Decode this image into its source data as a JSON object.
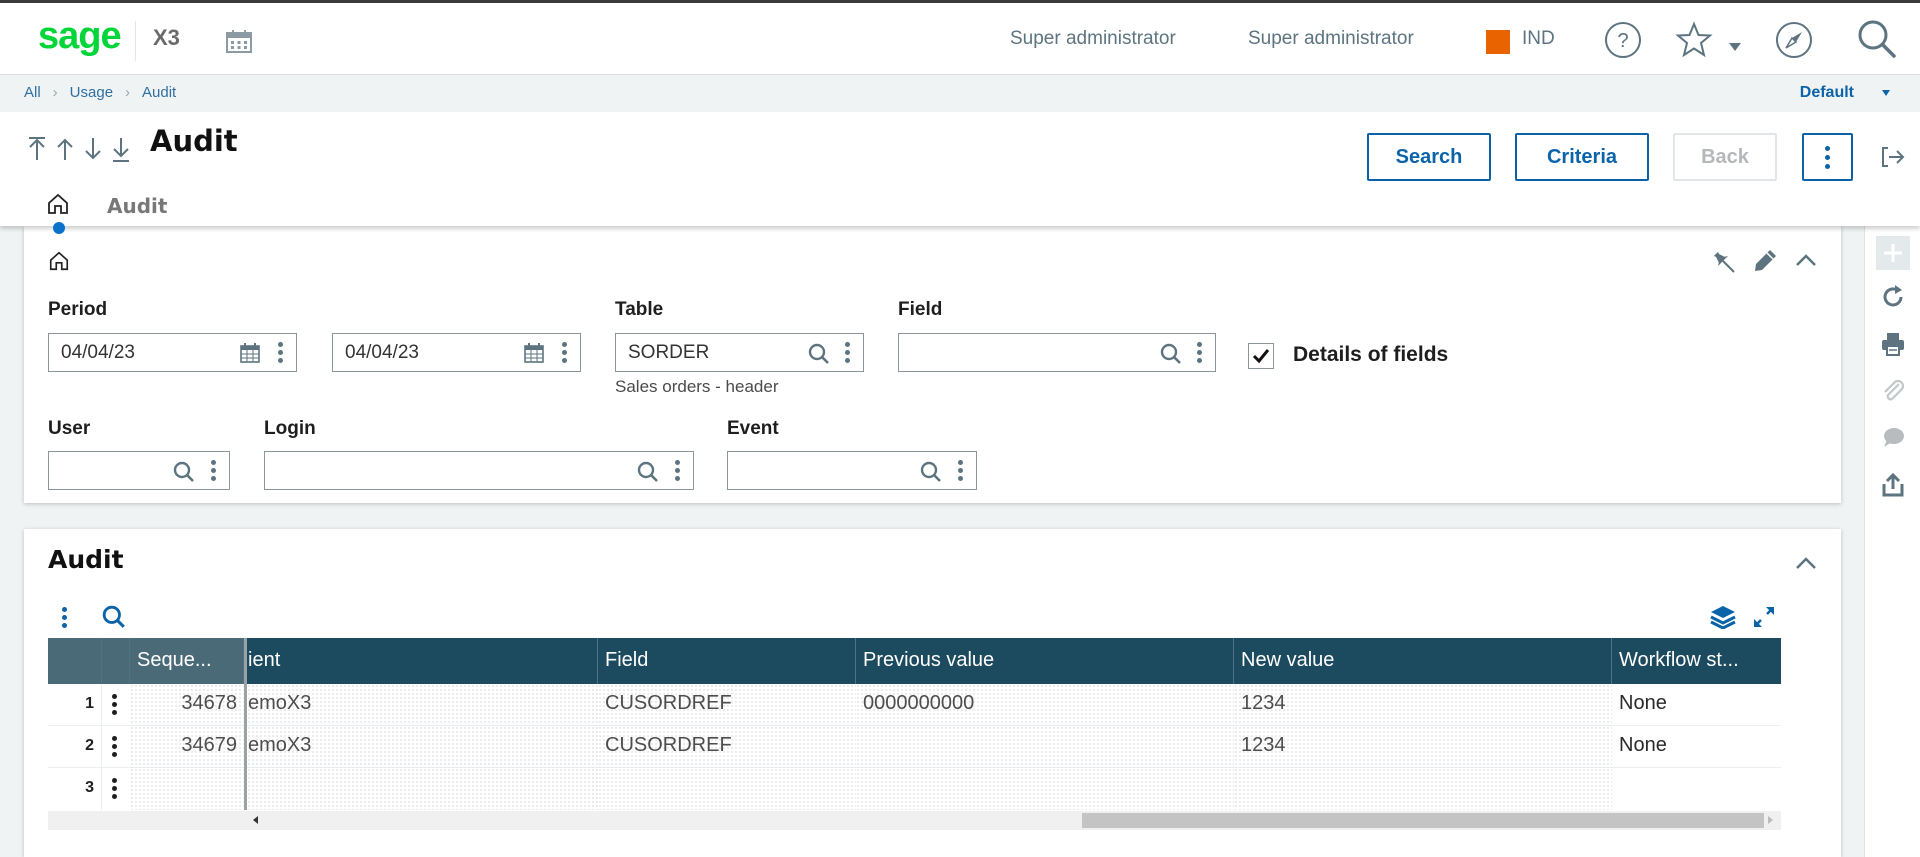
{
  "app": {
    "logo": "sage",
    "product": "X3",
    "user_name": "Super administrator",
    "user_role": "Super administrator",
    "folder": "IND",
    "folder_color": "#e96400",
    "accent_color": "#0b63a8",
    "logo_color": "#00d639"
  },
  "topbar_icons": [
    "calendar-icon",
    "help-icon",
    "star-icon",
    "caret-down-icon",
    "compass-icon",
    "search-icon"
  ],
  "breadcrumb": {
    "items": [
      "All",
      "Usage",
      "Audit"
    ],
    "view": "Default"
  },
  "header": {
    "title": "Audit",
    "nav_icons": [
      "first-record-icon",
      "previous-record-icon",
      "next-record-icon",
      "last-record-icon"
    ],
    "buttons": {
      "search": "Search",
      "criteria": "Criteria",
      "back": "Back"
    },
    "tabs": [
      {
        "icon": "home-icon",
        "active": true
      },
      {
        "label": "Audit"
      }
    ]
  },
  "criteria": {
    "period_label": "Period",
    "period_from": "04/04/23",
    "period_to": "04/04/23",
    "table_label": "Table",
    "table_value": "SORDER",
    "table_description": "Sales orders - header",
    "field_label": "Field",
    "field_value": "",
    "details_label": "Details of fields",
    "details_checked": true,
    "user_label": "User",
    "user_value": "",
    "login_label": "Login",
    "login_value": "",
    "event_label": "Event",
    "event_value": ""
  },
  "audit": {
    "title": "Audit",
    "columns": [
      "Seque...",
      "ient",
      "Field",
      "Previous value",
      "New value",
      "Workflow st..."
    ],
    "rows": [
      {
        "num": "1",
        "sequence": "34678",
        "client": "emoX3",
        "field": "CUSORDREF",
        "previous": "0000000000",
        "new": "1234",
        "workflow": "None"
      },
      {
        "num": "2",
        "sequence": "34679",
        "client": "emoX3",
        "field": "CUSORDREF",
        "previous": "",
        "new": "1234",
        "workflow": "None"
      },
      {
        "num": "3",
        "sequence": "",
        "client": "",
        "field": "",
        "previous": "",
        "new": "",
        "workflow": ""
      }
    ]
  },
  "right_sidebar": [
    "add-icon",
    "refresh-icon",
    "print-icon",
    "attachment-icon",
    "comment-icon",
    "export-icon"
  ]
}
